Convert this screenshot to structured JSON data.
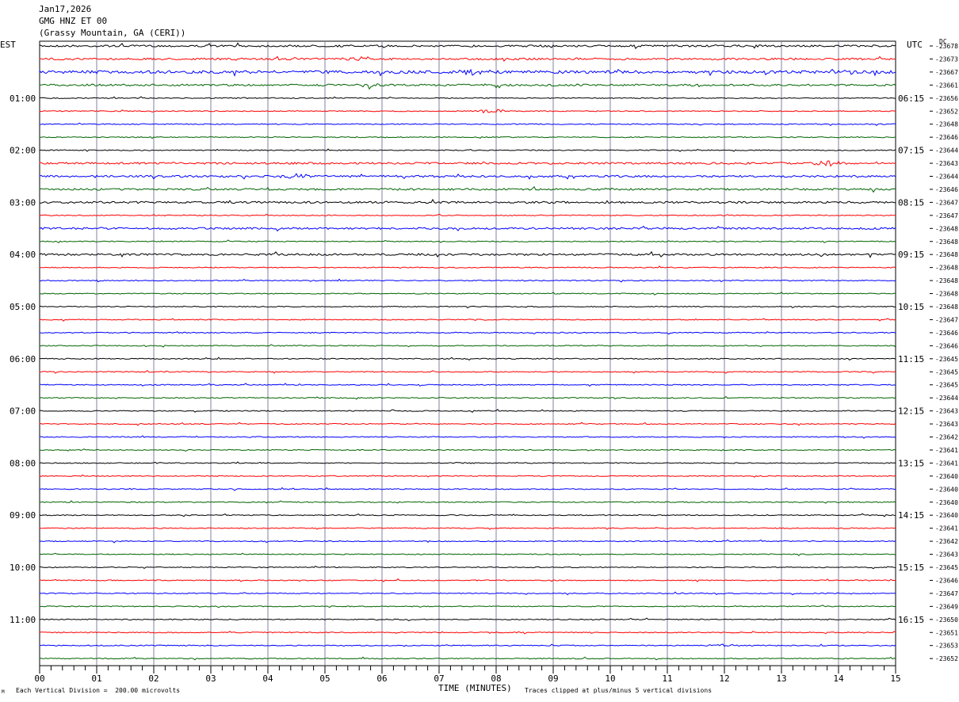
{
  "header": {
    "date": "Jan17,2026",
    "station": "GMG HNZ ET 00",
    "location": "(Grassy Mountain, GA (CERI))"
  },
  "left_zone": "EST",
  "right_zone": "UTC",
  "dc_label": "DC",
  "footer": {
    "xlabel": "TIME (MINUTES)",
    "scale_note": "Each Vertical Division =  200.00 microvolts",
    "clip_note": "Traces clipped at plus/minus 5 vertical divisions",
    "corner_mark": "M"
  },
  "colors": {
    "trace_cycle": [
      "#000000",
      "#ff0000",
      "#0000ff",
      "#006400"
    ],
    "grid": "#8080a0"
  },
  "chart_data": {
    "type": "line",
    "title": "GMG HNZ ET 00",
    "xlabel": "TIME (MINUTES)",
    "xlim": [
      0,
      15
    ],
    "x_ticks": [
      "00",
      "01",
      "02",
      "03",
      "04",
      "05",
      "06",
      "07",
      "08",
      "09",
      "10",
      "11",
      "12",
      "13",
      "14",
      "15"
    ],
    "rows_per_hour": 4,
    "minutes_per_row": 15,
    "left_hour_labels": [
      "01:00",
      "02:00",
      "03:00",
      "04:00",
      "05:00",
      "06:00",
      "07:00",
      "08:00",
      "09:00",
      "10:00",
      "11:00"
    ],
    "right_hour_labels": [
      "06:15",
      "07:15",
      "08:15",
      "09:15",
      "10:15",
      "11:15",
      "12:15",
      "13:15",
      "14:15",
      "15:15",
      "16:15"
    ],
    "dc_offsets": [
      -23678,
      -23673,
      -23667,
      -23661,
      -23656,
      -23652,
      -23648,
      -23646,
      -23644,
      -23643,
      -23644,
      -23646,
      -23647,
      -23647,
      -23648,
      -23648,
      -23648,
      -23648,
      -23648,
      -23648,
      -23648,
      -23647,
      -23646,
      -23646,
      -23645,
      -23645,
      -23645,
      -23644,
      -23643,
      -23643,
      -23642,
      -23641,
      -23641,
      -23640,
      -23640,
      -23640,
      -23640,
      -23641,
      -23642,
      -23643,
      -23645,
      -23646,
      -23647,
      -23649,
      -23650,
      -23651,
      -23653,
      -23652
    ],
    "trace_activity": [
      2,
      2,
      3,
      2,
      1,
      1,
      1,
      1,
      1,
      2,
      2,
      2,
      2,
      1,
      2,
      1,
      2,
      1,
      1,
      1,
      1,
      1,
      1,
      1,
      1,
      1,
      1,
      1,
      1,
      1,
      1,
      1,
      1,
      1,
      1,
      1,
      1,
      1,
      1,
      1,
      1,
      1,
      1,
      1,
      1,
      1,
      1,
      1
    ],
    "events": [
      {
        "row": 1,
        "minute": 5.6,
        "amp": 3
      },
      {
        "row": 2,
        "minute": 7.6,
        "amp": 5
      },
      {
        "row": 3,
        "minute": 5.8,
        "amp": 3
      },
      {
        "row": 5,
        "minute": 7.9,
        "amp": 4
      },
      {
        "row": 9,
        "minute": 13.8,
        "amp": 4
      },
      {
        "row": 10,
        "minute": 4.5,
        "amp": 4
      },
      {
        "row": 46,
        "minute": 12.0,
        "amp": 2
      }
    ]
  }
}
